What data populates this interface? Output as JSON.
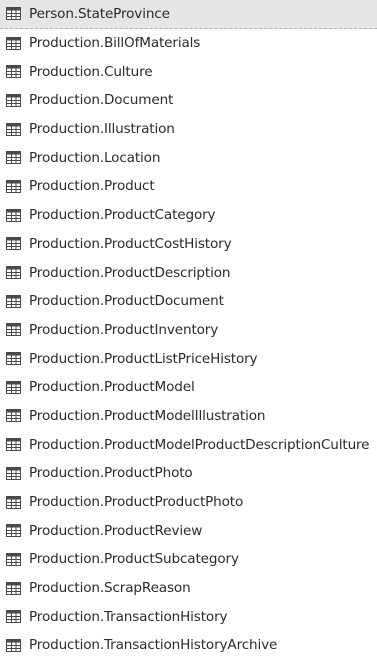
{
  "navigator": {
    "items": [
      {
        "label": "Person.StateProvince",
        "icon": "table-icon",
        "selected": true
      },
      {
        "label": "Production.BillOfMaterials",
        "icon": "table-icon"
      },
      {
        "label": "Production.Culture",
        "icon": "table-icon"
      },
      {
        "label": "Production.Document",
        "icon": "table-icon"
      },
      {
        "label": "Production.Illustration",
        "icon": "table-icon"
      },
      {
        "label": "Production.Location",
        "icon": "table-icon"
      },
      {
        "label": "Production.Product",
        "icon": "table-icon"
      },
      {
        "label": "Production.ProductCategory",
        "icon": "table-icon"
      },
      {
        "label": "Production.ProductCostHistory",
        "icon": "table-icon"
      },
      {
        "label": "Production.ProductDescription",
        "icon": "table-icon"
      },
      {
        "label": "Production.ProductDocument",
        "icon": "table-icon"
      },
      {
        "label": "Production.ProductInventory",
        "icon": "table-icon"
      },
      {
        "label": "Production.ProductListPriceHistory",
        "icon": "table-icon"
      },
      {
        "label": "Production.ProductModel",
        "icon": "table-icon"
      },
      {
        "label": "Production.ProductModelIllustration",
        "icon": "table-icon"
      },
      {
        "label": "Production.ProductModelProductDescriptionCulture",
        "icon": "table-icon"
      },
      {
        "label": "Production.ProductPhoto",
        "icon": "table-icon"
      },
      {
        "label": "Production.ProductProductPhoto",
        "icon": "table-icon"
      },
      {
        "label": "Production.ProductReview",
        "icon": "table-icon"
      },
      {
        "label": "Production.ProductSubcategory",
        "icon": "table-icon"
      },
      {
        "label": "Production.ScrapReason",
        "icon": "table-icon"
      },
      {
        "label": "Production.TransactionHistory",
        "icon": "table-icon"
      },
      {
        "label": "Production.TransactionHistoryArchive",
        "icon": "table-icon"
      }
    ]
  },
  "colors": {
    "selected_background": "#e6e6e6",
    "icon_stroke": "#4a4a4a",
    "text": "#2b2b2b"
  }
}
